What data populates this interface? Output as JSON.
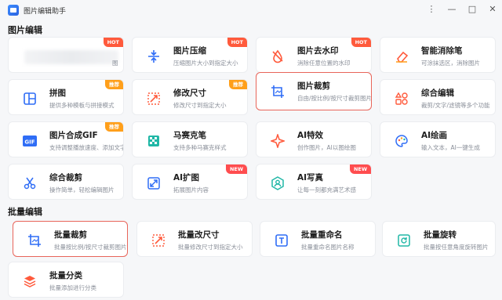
{
  "app": {
    "title": "图片编辑助手"
  },
  "window_controls": {
    "more": "⋮",
    "minimize": "—",
    "maximize": "□",
    "close": "✕"
  },
  "sections": {
    "edit": "图片编辑",
    "batch": "批量编辑"
  },
  "edit_cards": [
    {
      "name": "",
      "desc": "图",
      "badge": "HOT",
      "icon": "blurred-icon"
    },
    {
      "name": "图片压缩",
      "desc": "压缩图片大小到指定大小",
      "badge": "HOT",
      "icon": "compress-icon"
    },
    {
      "name": "图片去水印",
      "desc": "消除任意位置的水印",
      "badge": "HOT",
      "icon": "watermark-remove-icon"
    },
    {
      "name": "智能消除笔",
      "desc": "可涂抹选区，消除图片",
      "badge": "",
      "icon": "eraser-icon"
    },
    {
      "name": "拼图",
      "desc": "提供多种模板与拼接模式",
      "badge": "推荐",
      "icon": "collage-icon"
    },
    {
      "name": "修改尺寸",
      "desc": "修改尺寸到指定大小",
      "badge": "推荐",
      "icon": "resize-icon"
    },
    {
      "name": "图片裁剪",
      "desc": "自由/按比例/按尺寸裁剪图片",
      "badge": "",
      "icon": "crop-icon",
      "selected": true
    },
    {
      "name": "综合编辑",
      "desc": "裁剪/文字/滤镜等多个功能",
      "badge": "",
      "icon": "shapes-icon"
    },
    {
      "name": "图片合成GIF",
      "desc": "支持调整播放速度、添加文字",
      "badge": "推荐",
      "icon": "gif-icon"
    },
    {
      "name": "马赛克笔",
      "desc": "支持多种马赛克样式",
      "badge": "",
      "icon": "mosaic-icon"
    },
    {
      "name": "AI特效",
      "desc": "创作图片，AI以图绘图",
      "badge": "",
      "icon": "sparkle-icon"
    },
    {
      "name": "AI绘画",
      "desc": "输入文本，AI一键生成",
      "badge": "",
      "icon": "palette-icon"
    },
    {
      "name": "综合裁剪",
      "desc": "操作简单，轻松编辑图片",
      "badge": "",
      "icon": "scissors-icon"
    },
    {
      "name": "AI扩图",
      "desc": "拓展图片内容",
      "badge": "NEW",
      "icon": "expand-icon"
    },
    {
      "name": "AI写真",
      "desc": "让每一刻都充满艺术感",
      "badge": "NEW",
      "icon": "portrait-icon"
    }
  ],
  "batch_cards": [
    {
      "name": "批量裁剪",
      "desc": "批量按比例/按尺寸裁剪图片",
      "icon": "batch-crop-icon",
      "selected": true
    },
    {
      "name": "批量改尺寸",
      "desc": "批量修改尺寸到指定大小",
      "icon": "batch-resize-icon"
    },
    {
      "name": "批量重命名",
      "desc": "批量重命名图片名称",
      "icon": "batch-rename-icon"
    },
    {
      "name": "批量旋转",
      "desc": "批量按任意角度旋转图片",
      "icon": "batch-rotate-icon"
    },
    {
      "name": "批量分类",
      "desc": "批量添加进行分类",
      "icon": "batch-classify-icon"
    }
  ],
  "colors": {
    "accent": "#2f6df6",
    "hot": "#ff5a3c",
    "recommend": "#ff9f1a",
    "selected": "#e8655a"
  }
}
